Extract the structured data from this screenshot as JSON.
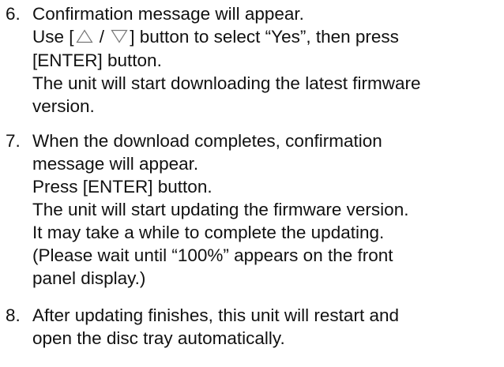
{
  "steps": [
    {
      "number": "6.",
      "lines": [
        "Confirmation message will appear.",
        {
          "pre": "Use [",
          "up_icon": "triangle-up-icon",
          "sep": " / ",
          "down_icon": "triangle-down-icon",
          "post": "] button to select “Yes”, then press"
        },
        "[ENTER] button.",
        "The unit will start downloading the latest firmware",
        "version."
      ]
    },
    {
      "number": "7.",
      "lines": [
        "When the download completes, confirmation",
        "message will appear.",
        "Press [ENTER] button.",
        "The unit will start updating the firmware version.",
        "It may take a while to complete the updating.",
        "(Please wait until “100%” appears on the front",
        "panel display.)"
      ]
    },
    {
      "number": "8.",
      "lines": [
        "After updating finishes, this unit will restart and",
        "open the disc tray automatically."
      ]
    }
  ]
}
